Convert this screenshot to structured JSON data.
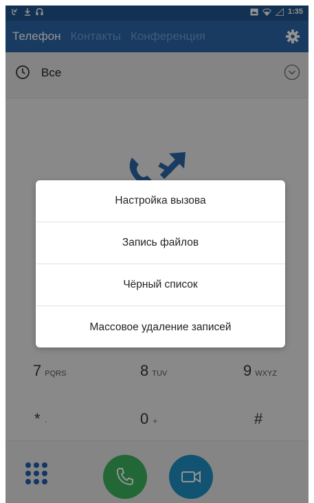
{
  "status_bar": {
    "time": "1:35",
    "left_icons": [
      "voicemail-icon",
      "download-icon",
      "headset-icon"
    ],
    "right_icons": [
      "photo-icon",
      "wifi-icon",
      "signal-icon"
    ]
  },
  "header": {
    "tabs": [
      {
        "label": "Телефон",
        "active": true
      },
      {
        "label": "Контакты",
        "active": false
      },
      {
        "label": "Конференция",
        "active": false
      }
    ],
    "settings_icon": "gear-icon"
  },
  "filter": {
    "label": "Все",
    "icon": "clock-icon",
    "dropdown_icon": "chevron-down-icon"
  },
  "dialpad": {
    "keys": [
      {
        "digit": "7",
        "letters": "PQRS"
      },
      {
        "digit": "8",
        "letters": "TUV"
      },
      {
        "digit": "9",
        "letters": "WXYZ"
      },
      {
        "digit": "*",
        "letters": "·"
      },
      {
        "digit": "0",
        "letters": "+"
      },
      {
        "digit": "#",
        "letters": ""
      }
    ]
  },
  "bottom_bar": {
    "grid_icon": "keypad-grid-icon",
    "call_icon": "phone-icon",
    "video_icon": "video-camera-icon"
  },
  "dialog": {
    "items": [
      {
        "label": "Настройка вызова"
      },
      {
        "label": "Запись файлов"
      },
      {
        "label": "Чёрный список"
      },
      {
        "label": "Массовое удаление записей"
      }
    ]
  },
  "colors": {
    "status_bar": "#22568f",
    "header": "#2c67a7",
    "tab_inactive": "#6f9ed2",
    "call_green": "#3bb35d",
    "video_blue": "#1f8fc4",
    "keypad_grid": "#1f5fae"
  }
}
